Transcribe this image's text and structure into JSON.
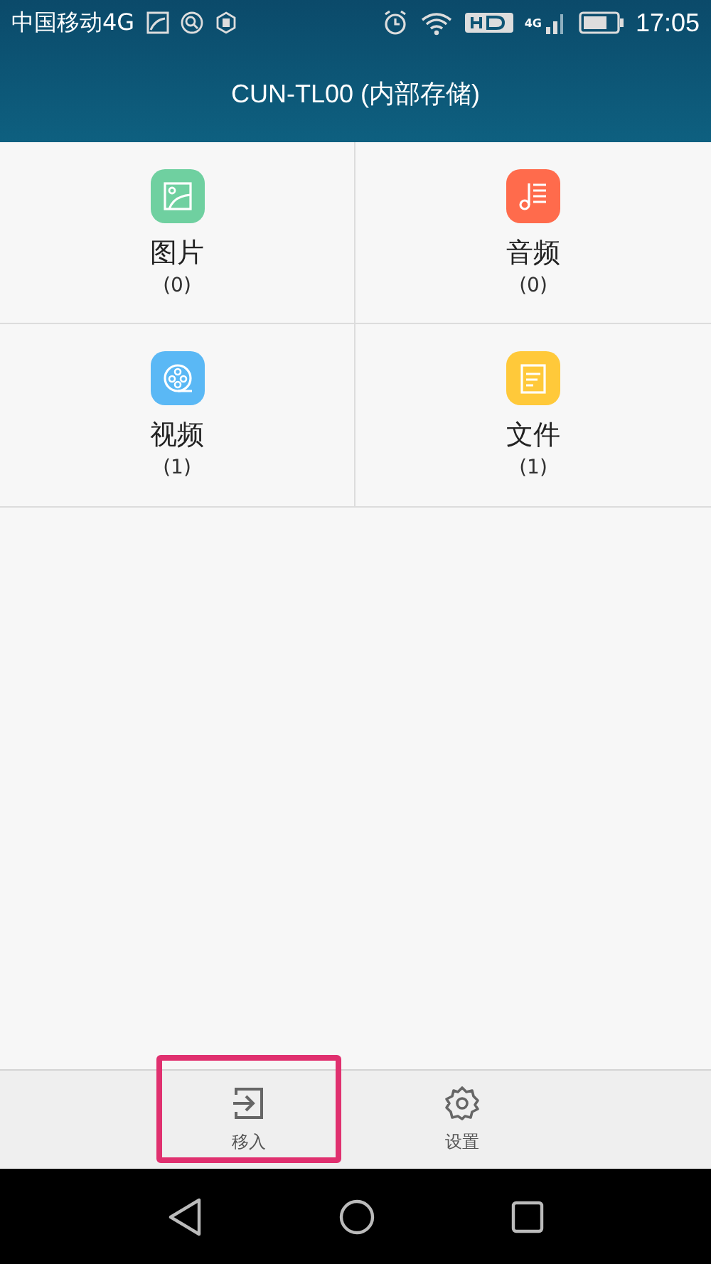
{
  "status_bar": {
    "carrier": "中国移动4G",
    "network_label": "4G",
    "time": "17:05"
  },
  "header": {
    "title": "CUN-TL00 (内部存储)"
  },
  "categories": [
    {
      "kind": "image",
      "label": "图片",
      "count": "(0)",
      "color": "#6fd0a0"
    },
    {
      "kind": "audio",
      "label": "音频",
      "count": "(0)",
      "color": "#ff6b4c"
    },
    {
      "kind": "video",
      "label": "视频",
      "count": "(1)",
      "color": "#5ab8f5"
    },
    {
      "kind": "document",
      "label": "文件",
      "count": "(1)",
      "color": "#ffc93a"
    }
  ],
  "toolbar": [
    {
      "kind": "move-in",
      "label": "移入",
      "highlighted": true
    },
    {
      "kind": "settings",
      "label": "设置",
      "highlighted": false
    }
  ]
}
